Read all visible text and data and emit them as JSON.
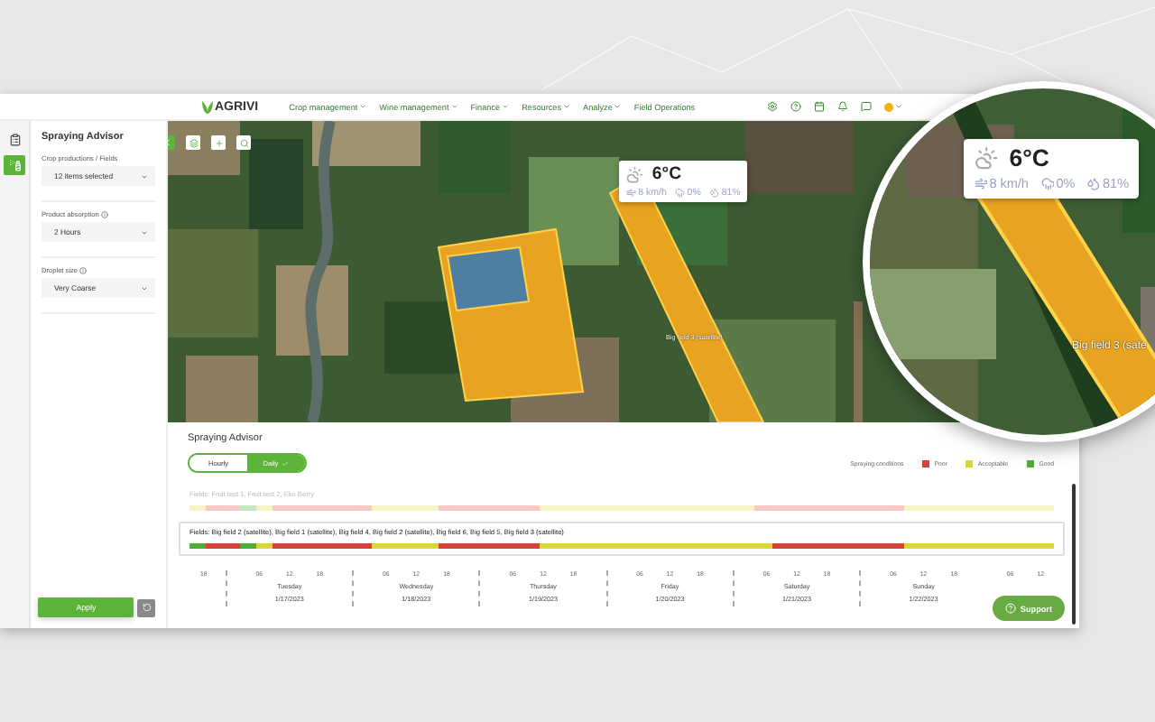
{
  "nav": {
    "logo": "AGRIVI",
    "menu": [
      {
        "label": "Crop management",
        "dropdown": true
      },
      {
        "label": "Wine management",
        "dropdown": true
      },
      {
        "label": "Finance",
        "dropdown": true
      },
      {
        "label": "Resources",
        "dropdown": true
      },
      {
        "label": "Analyze",
        "dropdown": true
      },
      {
        "label": "Field Operations",
        "dropdown": false
      }
    ]
  },
  "rail": [
    {
      "kind": "clipboard",
      "selected": false
    },
    {
      "kind": "sprayer",
      "selected": true
    }
  ],
  "sidebar": {
    "title": "Spraying Advisor",
    "fields": [
      {
        "label": "Crop productions / Fields",
        "info": false,
        "value": "12 items selected"
      },
      {
        "label": "Product absorption",
        "info": true,
        "value": "2 Hours"
      },
      {
        "label": "Droplet size",
        "info": true,
        "value": "Very Coarse"
      }
    ],
    "apply": "Apply"
  },
  "map": {
    "labels": [
      "Big field 3 (satellite)"
    ],
    "weather": {
      "temperature": "6°C",
      "wind": "8 km/h",
      "rain": "0%",
      "humidity": "81%"
    }
  },
  "magnifier": {
    "label": "Big field 3 (sate",
    "weather": {
      "temperature": "6°C",
      "wind": "8 km/h",
      "rain": "0%",
      "humidity": "81%"
    }
  },
  "advisor": {
    "title": "Spraying Advisor",
    "modes": [
      {
        "label": "Hourly",
        "selected": false
      },
      {
        "label": "Daily",
        "selected": true
      }
    ],
    "legend": {
      "title": "Spraying conditions",
      "items": [
        {
          "label": "Poor",
          "color": "#d9403a"
        },
        {
          "label": "Acceptable",
          "color": "#d8d830"
        },
        {
          "label": "Good",
          "color": "#4caf35"
        }
      ]
    },
    "groups": [
      {
        "title": "Fields: Fruit test 1, Fruit test 2, Eko Berry",
        "selected": false,
        "slots": [
          {
            "color": "#f4f4c4"
          },
          {
            "color": "#f6c8c6"
          },
          {
            "color": "#f6c8c6"
          },
          {
            "color": "#c6e6be"
          },
          {
            "color": "#f4f4c4"
          },
          {
            "color": "#f6c8c6"
          },
          {
            "color": "#f6c8c6"
          },
          {
            "color": "#f6c8c6"
          },
          {
            "color": "#f6c8c6"
          },
          {
            "color": "#f6c8c6"
          },
          {
            "color": "#f6c8c6"
          },
          {
            "color": "#f4f4c4"
          },
          {
            "color": "#f4f4c4"
          },
          {
            "color": "#f4f4c4"
          },
          {
            "color": "#f4f4c4"
          },
          {
            "color": "#f6c8c6"
          },
          {
            "color": "#f6c8c6"
          },
          {
            "color": "#f6c8c6"
          },
          {
            "color": "#f6c8c6"
          },
          {
            "color": "#f6c8c6"
          },
          {
            "color": "#f6c8c6"
          },
          {
            "color": "#f4f4c4"
          },
          {
            "color": "#f4f4c4"
          },
          {
            "color": "#f4f4c4"
          },
          {
            "color": "#f4f4c4"
          },
          {
            "color": "#f4f4c4"
          },
          {
            "color": "#f4f4c4"
          },
          {
            "color": "#f4f4c4"
          },
          {
            "color": "#f4f4c4"
          },
          {
            "color": "#f4f4c4"
          },
          {
            "color": "#f4f4c4"
          },
          {
            "color": "#f4f4c4"
          },
          {
            "color": "#f4f4c4"
          },
          {
            "color": "#f4f4c4"
          },
          {
            "color": "#f6c8c6"
          },
          {
            "color": "#f6c8c6"
          },
          {
            "color": "#f6c8c6"
          },
          {
            "color": "#f6c8c6"
          },
          {
            "color": "#f6c8c6"
          },
          {
            "color": "#f6c8c6"
          },
          {
            "color": "#f6c8c6"
          },
          {
            "color": "#f6c8c6"
          },
          {
            "color": "#f6c8c6"
          },
          {
            "color": "#f4f4c4"
          },
          {
            "color": "#f4f4c4"
          },
          {
            "color": "#f4f4c4"
          },
          {
            "color": "#f4f4c4"
          },
          {
            "color": "#f4f4c4"
          },
          {
            "color": "#f4f4c4"
          },
          {
            "color": "#f4f4c4"
          },
          {
            "color": "#f4f4c4"
          },
          {
            "color": "#f4f4c4"
          }
        ]
      },
      {
        "title": "Fields: Big field 2 (satellite), Big field 1 (satellite), Big field 4, Big field 2 (satellite), Big field 6, Big field 5, Big field 3 (satellite)",
        "selected": true,
        "slots": [
          {
            "color": "#4caf35"
          },
          {
            "color": "#d9403a"
          },
          {
            "color": "#d9403a"
          },
          {
            "color": "#4caf35"
          },
          {
            "color": "#d8d830"
          },
          {
            "color": "#d9403a"
          },
          {
            "color": "#d9403a"
          },
          {
            "color": "#d9403a"
          },
          {
            "color": "#d9403a"
          },
          {
            "color": "#d9403a"
          },
          {
            "color": "#d9403a"
          },
          {
            "color": "#d8d830"
          },
          {
            "color": "#d8d830"
          },
          {
            "color": "#d8d830"
          },
          {
            "color": "#d8d830"
          },
          {
            "color": "#d9403a"
          },
          {
            "color": "#d9403a"
          },
          {
            "color": "#d9403a"
          },
          {
            "color": "#d9403a"
          },
          {
            "color": "#d9403a"
          },
          {
            "color": "#d9403a"
          },
          {
            "color": "#d8d830"
          },
          {
            "color": "#d8d830"
          },
          {
            "color": "#d8d830"
          },
          {
            "color": "#d8d830"
          },
          {
            "color": "#d8d830"
          },
          {
            "color": "#d8d830"
          },
          {
            "color": "#d8d830"
          },
          {
            "color": "#d8d830"
          },
          {
            "color": "#d8d830"
          },
          {
            "color": "#d8d830"
          },
          {
            "color": "#d8d830"
          },
          {
            "color": "#d8d830"
          },
          {
            "color": "#d8d830"
          },
          {
            "color": "#d8d830"
          },
          {
            "color": "#d9403a"
          },
          {
            "color": "#d9403a"
          },
          {
            "color": "#d9403a"
          },
          {
            "color": "#d9403a"
          },
          {
            "color": "#d9403a"
          },
          {
            "color": "#d9403a"
          },
          {
            "color": "#d9403a"
          },
          {
            "color": "#d9403a"
          },
          {
            "color": "#d8d830"
          },
          {
            "color": "#d8d830"
          },
          {
            "color": "#d8d830"
          },
          {
            "color": "#d8d830"
          },
          {
            "color": "#d8d830"
          },
          {
            "color": "#d8d830"
          },
          {
            "color": "#d8d830"
          },
          {
            "color": "#d8d830"
          },
          {
            "color": "#d8d830"
          }
        ]
      }
    ],
    "timeline": {
      "leading_ticks": [
        "18"
      ],
      "days": [
        {
          "ticks": [
            "06",
            "12",
            "18"
          ],
          "day": "Tuesday",
          "date": "1/17/2023"
        },
        {
          "ticks": [
            "06",
            "12",
            "18"
          ],
          "day": "Wednesday",
          "date": "1/18/2023"
        },
        {
          "ticks": [
            "06",
            "12",
            "18"
          ],
          "day": "Thursday",
          "date": "1/19/2023"
        },
        {
          "ticks": [
            "06",
            "12",
            "18"
          ],
          "day": "Friday",
          "date": "1/20/2023"
        },
        {
          "ticks": [
            "06",
            "12",
            "18"
          ],
          "day": "Saturday",
          "date": "1/21/2023"
        },
        {
          "ticks": [
            "06",
            "12",
            "18"
          ],
          "day": "Sunday",
          "date": "1/22/2023"
        }
      ],
      "trailing_ticks": [
        "06",
        "12"
      ]
    }
  },
  "support": "Support"
}
